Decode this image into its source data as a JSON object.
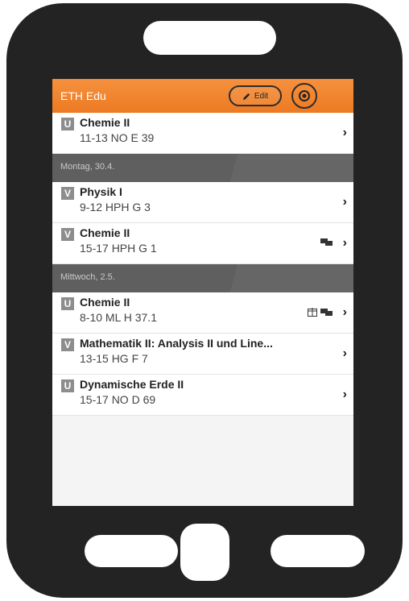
{
  "app": {
    "title": "ETH Edu",
    "edit_label": "Edit",
    "accent": "#ee8030"
  },
  "rows": {
    "r1": {
      "badge": "U",
      "course": "Chemie II",
      "info": "11-13   NO E 39"
    },
    "d1": {
      "label": "Montag, 30.4."
    },
    "r2": {
      "badge": "V",
      "course": "Physik I",
      "info": "9-12   HPH G 3"
    },
    "r3": {
      "badge": "V",
      "course": "Chemie II",
      "info": "15-17   HPH G 1"
    },
    "d2": {
      "label": "Mittwoch, 2.5."
    },
    "r4": {
      "badge": "U",
      "course": "Chemie II",
      "info": "8-10   ML H 37.1"
    },
    "r5": {
      "badge": "V",
      "course": "Mathematik II: Analysis II und Line...",
      "info": "13-15   HG F 7"
    },
    "r6": {
      "badge": "U",
      "course": "Dynamische Erde II",
      "info": "15-17   NO D 69"
    }
  },
  "icons": {
    "edit": "pencil-icon",
    "settings": "gear-icon",
    "chevron": "chevron-right-icon",
    "chat": "chat-icon",
    "calendar": "calendar-icon"
  }
}
